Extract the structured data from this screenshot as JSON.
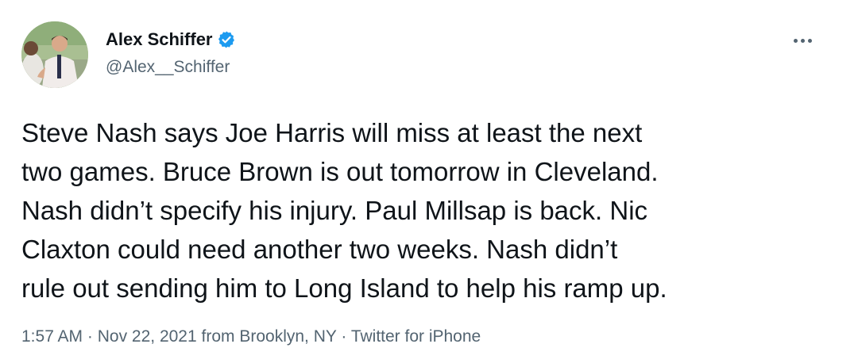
{
  "author": {
    "display_name": "Alex Schiffer",
    "handle": "@Alex__Schiffer",
    "verified": true,
    "verified_icon": "verified-badge-icon",
    "avatar_icon": "profile-photo"
  },
  "menu": {
    "icon": "more-options-icon"
  },
  "tweet": {
    "lines": [
      "Steve Nash says Joe Harris will miss at least the next",
      "two games. Bruce Brown is out tomorrow in Cleveland.",
      "Nash didn’t specify his injury. Paul Millsap is back. Nic",
      "Claxton could need another two weeks. Nash didn’t",
      "rule out sending him to Long Island to help his ramp up."
    ]
  },
  "meta": {
    "time": "1:57 AM",
    "sep1": " · ",
    "date": "Nov 22, 2021",
    "from_word": " from ",
    "location": "Brooklyn, NY",
    "sep2": " · ",
    "source": "Twitter for iPhone"
  },
  "colors": {
    "text_primary": "#0f1419",
    "text_secondary": "#536471",
    "verified_blue": "#1d9bf0",
    "background": "#ffffff"
  }
}
